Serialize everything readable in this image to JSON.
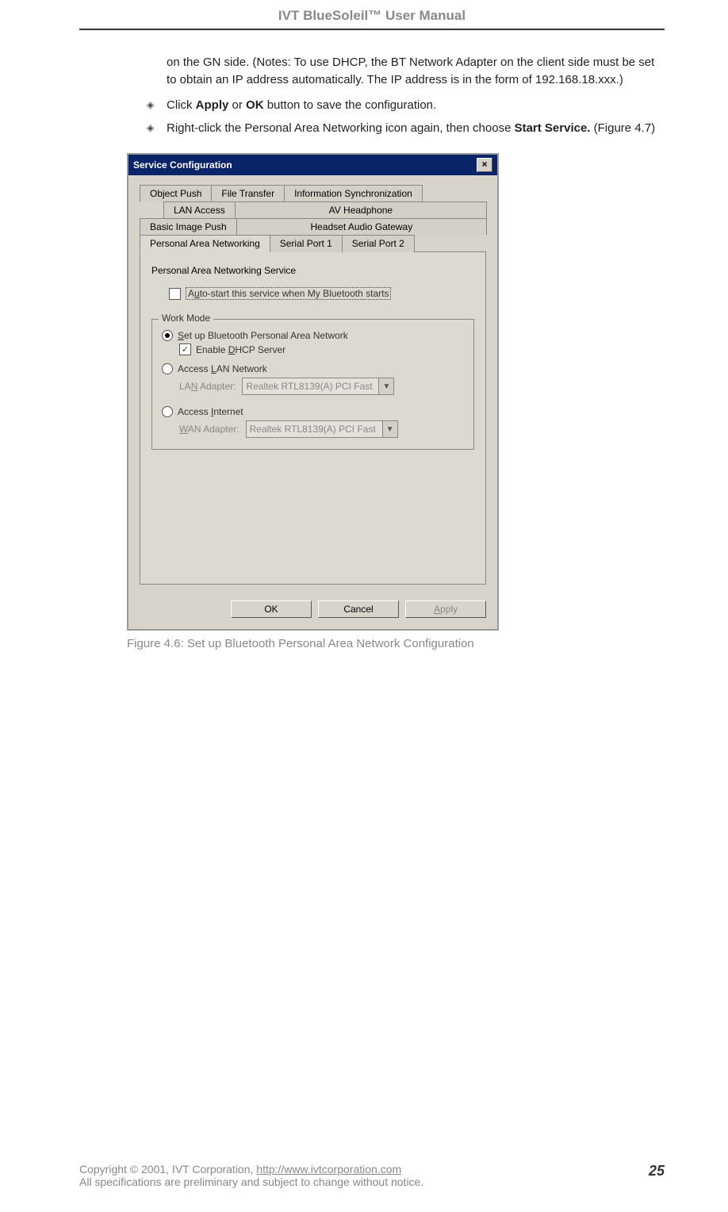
{
  "header": {
    "title": "IVT BlueSoleil™ User Manual"
  },
  "body": {
    "para1": "on the GN side. (Notes: To use DHCP, the BT Network Adapter on the client side must be set to obtain an IP address automatically. The IP address is in the form of 192.168.18.xxx.)",
    "bullet1_pre": "Click ",
    "bullet1_b1": "Apply",
    "bullet1_mid": " or ",
    "bullet1_b2": "OK",
    "bullet1_post": " button to save the configuration.",
    "bullet2_pre": "Right-click the Personal Area Networking icon again, then choose ",
    "bullet2_b": "Start Service.",
    "bullet2_post": " (Figure 4.7)"
  },
  "dialog": {
    "title": "Service Configuration",
    "tabs_r1": [
      "Object Push",
      "File Transfer",
      "Information Synchronization"
    ],
    "tabs_r2": [
      "LAN Access",
      "AV Headphone"
    ],
    "tabs_r3": [
      "Basic Image Push",
      "Headset Audio Gateway"
    ],
    "tabs_r4": [
      "Personal Area Networking",
      "Serial Port 1",
      "Serial Port 2"
    ],
    "pane": {
      "heading": "Personal Area Networking Service",
      "autostart": "Auto-start this service when My Bluetooth starts",
      "groupbox": "Work Mode",
      "opt1": "Set up Bluetooth Personal Area Network",
      "dhcp": "Enable DHCP Server",
      "opt2": "Access LAN Network",
      "lan_label": "LAN Adapter:",
      "lan_value": "Realtek RTL8139(A) PCI Fast",
      "opt3": "Access Internet",
      "wan_label": "WAN Adapter:",
      "wan_value": "Realtek RTL8139(A) PCI Fast"
    },
    "buttons": {
      "ok": "OK",
      "cancel": "Cancel",
      "apply": "Apply"
    }
  },
  "caption": "Figure 4.6: Set up Bluetooth Personal Area Network Configuration",
  "footer": {
    "line1_pre": "Copyright © 2001, IVT Corporation, ",
    "link": "http://www.ivtcorporation.com",
    "line2": "All specifications are preliminary and subject to change without notice.",
    "page": "25"
  }
}
